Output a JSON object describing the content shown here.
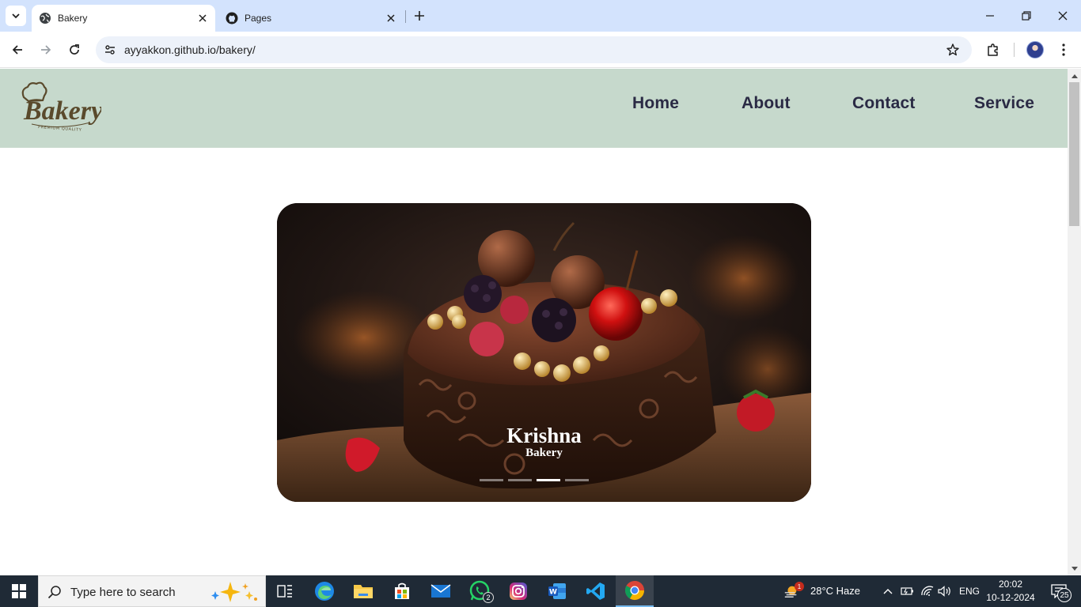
{
  "browser": {
    "tabs": [
      {
        "title": "Bakery",
        "active": true
      },
      {
        "title": "Pages",
        "active": false
      }
    ],
    "url": "ayyakkon.github.io/bakery/"
  },
  "site": {
    "logo_text": "Bakery",
    "logo_tagline": "PREMIUM QUALITY",
    "nav": [
      "Home",
      "About",
      "Contact",
      "Service"
    ],
    "hero": {
      "title": "Krishna",
      "subtitle": "Bakery",
      "slide_count": 4,
      "active_slide": 3
    }
  },
  "taskbar": {
    "search_placeholder": "Type here to search",
    "apps": [
      "task-view",
      "edge",
      "file-explorer",
      "microsoft-store",
      "mail",
      "whatsapp",
      "instagram",
      "word",
      "vscode",
      "chrome"
    ],
    "whatsapp_badge": "2",
    "weather_badge": "1",
    "weather": "28°C  Haze",
    "language": "ENG",
    "time": "20:02",
    "date": "10-12-2024",
    "notification_count": "25"
  },
  "colors": {
    "tabstrip": "#d3e3fd",
    "omnibox": "#edf2fa",
    "header_bg": "#c6d9cc",
    "nav_text": "#2a2a44",
    "taskbar": "#1f2a36"
  }
}
